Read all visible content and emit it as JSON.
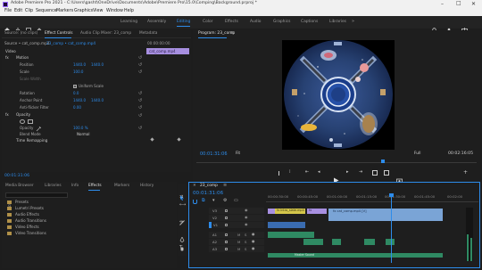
{
  "window": {
    "title": "Adobe Premiere Pro 2021 - C:\\Users\\gasht\\OneDrive\\Documents\\Adobe\\Premiere Pro\\15.0\\Comping\\Background.prproj *",
    "min": "–",
    "max": "□",
    "close": "✕"
  },
  "menu": [
    "File",
    "Edit",
    "Clip",
    "Sequence",
    "Markers",
    "Graphics",
    "View",
    "Window",
    "Help"
  ],
  "workspaces": [
    "Learning",
    "Assembly",
    "Editing",
    "Color",
    "Effects",
    "Audio",
    "Graphics",
    "Captions",
    "Libraries"
  ],
  "workspace_more": "»",
  "source_tabs": [
    "Source: (no clips)",
    "Effect Controls",
    "Audio Clip Mixer: 23_comp",
    "Metadata"
  ],
  "effect_controls": {
    "header_source": "Source • cat_comp.mp4",
    "header_seq": "23_comp • cat_comp.mp4",
    "ruler_time": "00:00:00:00",
    "clip_label": "cat_comp.mp4",
    "section_video": "Video",
    "motion_label": "Motion",
    "opacity_label": "Opacity",
    "time_remap_label": "Time Remapping",
    "rows": [
      {
        "label": "Position",
        "v1": "1440.0",
        "v2": "1440.0"
      },
      {
        "label": "Scale",
        "v1": "100.0",
        "v2": ""
      },
      {
        "label": "Scale Width",
        "v1": "",
        "v2": ""
      },
      {
        "label": "",
        "v1": "",
        "v2": "Uniform Scale"
      },
      {
        "label": "Rotation",
        "v1": "0.0",
        "v2": ""
      },
      {
        "label": "Anchor Point",
        "v1": "1440.0",
        "v2": "1440.0"
      },
      {
        "label": "Anti-flicker Filter",
        "v1": "0.00",
        "v2": ""
      }
    ],
    "opacity_row": {
      "label": "Opacity",
      "v1": "100.0 %"
    },
    "blend_row": {
      "label": "Blend Mode",
      "v1": "Normal"
    },
    "bottom_time": "00:01:31:06"
  },
  "program": {
    "tab": "Program: 23_comp",
    "timecode": "00:01:31:06",
    "fit": "Fit",
    "quality": "Full",
    "duration": "00:02:16:05"
  },
  "project": {
    "tabs": [
      "Media Browser",
      "Libraries",
      "Info",
      "Effects",
      "Markers",
      "History"
    ],
    "search": "",
    "items": [
      "Presets",
      "Lumetri Presets",
      "Audio Effects",
      "Audio Transitions",
      "Video Effects",
      "Video Transitions"
    ]
  },
  "timeline": {
    "tab": "23_comp",
    "timecode": "00:01:31:06",
    "ruler": [
      "00:00:30:00",
      "00:00:45:00",
      "00:01:00:00",
      "00:01:15:00",
      "00:01:30:00",
      "00:01:45:00",
      "00:02:00"
    ],
    "video_tracks": [
      "V3",
      "V2",
      "V1"
    ],
    "audio_tracks": [
      "A1",
      "A2",
      "A3"
    ],
    "clips": [
      {
        "label": "fx Intro_slate.mp4"
      },
      {
        "label": "fx"
      },
      {
        "label": "fx cat_comp.mp4 [V]"
      }
    ],
    "audio_clip_label": "Master Sound"
  },
  "colors": {
    "accent": "#2d8ceb",
    "clip_yellow": "#d4c64b",
    "clip_violet": "#a78fe0",
    "clip_blue": "#7aa4d6",
    "audio_green": "#2f8a63"
  }
}
